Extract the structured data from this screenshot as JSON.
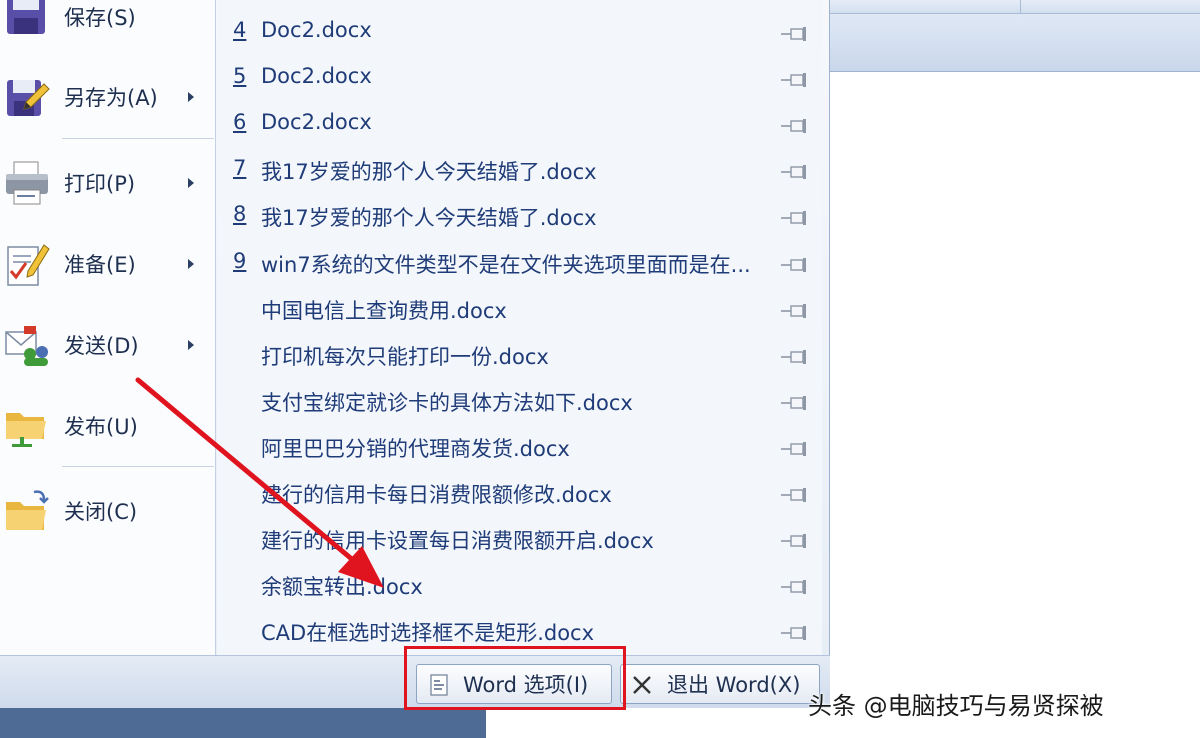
{
  "left_menu": {
    "items": [
      {
        "label": "保存(S)",
        "icon": "save-icon",
        "has_submenu": false
      },
      {
        "label": "另存为(A)",
        "icon": "save-as-icon",
        "has_submenu": true
      },
      {
        "label": "打印(P)",
        "icon": "printer-icon",
        "has_submenu": true
      },
      {
        "label": "准备(E)",
        "icon": "prepare-icon",
        "has_submenu": true
      },
      {
        "label": "发送(D)",
        "icon": "send-icon",
        "has_submenu": true
      },
      {
        "label": "发布(U)",
        "icon": "publish-icon",
        "has_submenu": false
      },
      {
        "label": "关闭(C)",
        "icon": "close-folder-icon",
        "has_submenu": false
      }
    ]
  },
  "recent_documents": [
    {
      "number": "4",
      "name": "Doc2.docx"
    },
    {
      "number": "5",
      "name": "Doc2.docx"
    },
    {
      "number": "6",
      "name": "Doc2.docx"
    },
    {
      "number": "7",
      "name": "我17岁爱的那个人今天结婚了.docx"
    },
    {
      "number": "8",
      "name": "我17岁爱的那个人今天结婚了.docx"
    },
    {
      "number": "9",
      "name": "win7系统的文件类型不是在文件夹选项里面而是在..."
    },
    {
      "number": "",
      "name": "中国电信上查询费用.docx"
    },
    {
      "number": "",
      "name": "打印机每次只能打印一份.docx"
    },
    {
      "number": "",
      "name": "支付宝绑定就诊卡的具体方法如下.docx"
    },
    {
      "number": "",
      "name": "阿里巴巴分销的代理商发货.docx"
    },
    {
      "number": "",
      "name": "建行的信用卡每日消费限额修改.docx"
    },
    {
      "number": "",
      "name": "建行的信用卡设置每日消费限额开启.docx"
    },
    {
      "number": "",
      "name": "余额宝转出.docx"
    },
    {
      "number": "",
      "name": "CAD在框选时选择框不是矩形.docx"
    }
  ],
  "buttons": {
    "options_label": "Word 选项(I)",
    "exit_label": "退出 Word(X)"
  },
  "watermark": "头条 @电脑技巧与易贤探被",
  "colors": {
    "annotation_red": "#e0141e",
    "link_blue": "#1f3c78",
    "menu_text": "#1e2f4f"
  }
}
